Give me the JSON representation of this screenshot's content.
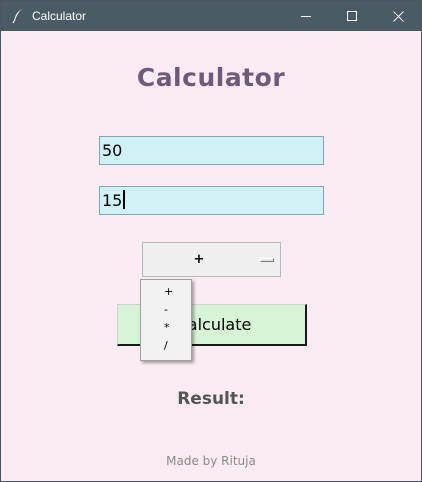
{
  "window": {
    "title": "Calculator",
    "icon": "feather-icon",
    "controls": [
      "minimize-icon",
      "maximize-icon",
      "close-icon"
    ]
  },
  "app": {
    "heading": "Calculator",
    "first_number": "50",
    "second_number": "15",
    "operator": {
      "selected": "+",
      "options": [
        "+",
        "-",
        "*",
        "/"
      ]
    },
    "calculate_label": "Calculate",
    "result_label": "Result:",
    "result_value": "",
    "footer": "Made by Rituja"
  },
  "colors": {
    "background": "#fbecf3",
    "titlebar": "#4b5b66",
    "heading": "#6f5a7c",
    "entry_bg": "#d0f1f5",
    "button_bg": "#d7f4d6"
  }
}
